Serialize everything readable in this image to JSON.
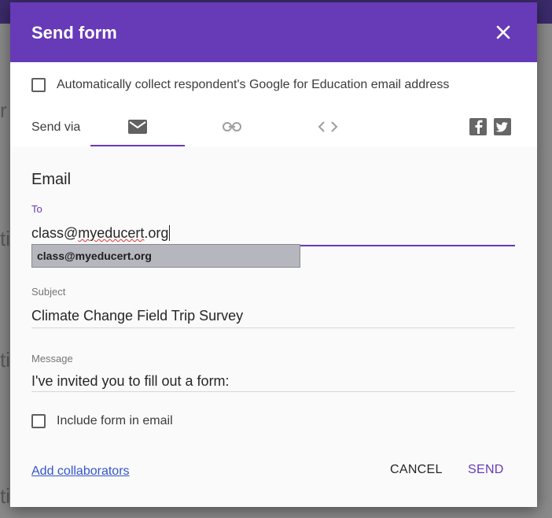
{
  "dialog": {
    "title": "Send form",
    "collect_email_label": "Automatically collect respondent's Google for Education email address",
    "send_via_label": "Send via",
    "tabs": [
      "email-icon",
      "link-icon",
      "embed-icon"
    ],
    "social": [
      "facebook-icon",
      "twitter-icon"
    ]
  },
  "email": {
    "section_title": "Email",
    "to_label": "To",
    "to_value_prefix": "class@",
    "to_value_misspelled": "myeducert",
    "to_value_suffix": ".org",
    "autocomplete_suggestion": "class@myeducert.org",
    "subject_label": "Subject",
    "subject_value": "Climate Change Field Trip Survey",
    "message_label": "Message",
    "message_value": "I've invited you to fill out a form:",
    "include_form_label": "Include form in email"
  },
  "footer": {
    "add_collaborators": "Add collaborators",
    "cancel": "CANCEL",
    "send": "SEND"
  },
  "colors": {
    "accent": "#673ab7",
    "link": "#3355cc"
  }
}
